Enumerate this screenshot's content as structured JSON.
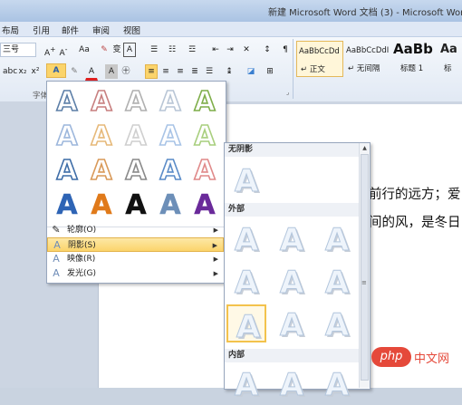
{
  "window": {
    "title": "新建 Microsoft Word 文档 (3) - Microsoft Word"
  },
  "ribbon": {
    "tabs": [
      "布局",
      "引用",
      "邮件",
      "审阅",
      "视图"
    ],
    "font_size_value": "三号",
    "font_group_label": "字体",
    "styles": [
      {
        "sample": "AaBbCcDd",
        "label": "↵ 正文"
      },
      {
        "sample": "AaBbCcDdI",
        "label": "↵ 无间隔"
      },
      {
        "sample": "AaBb",
        "label": "标题 1"
      },
      {
        "sample": "Aa",
        "label": "标"
      }
    ]
  },
  "document": {
    "lines": [
      "前行的远方；爱",
      "间的风，是冬日"
    ]
  },
  "text_effects_menu": {
    "menu_items": [
      {
        "icon": "pen-icon",
        "glyph": "✎",
        "label": "轮廓(O)"
      },
      {
        "icon": "shadow-a-icon",
        "glyph": "A",
        "label": "阴影(S)"
      },
      {
        "icon": "reflection-a-icon",
        "glyph": "A",
        "label": "映像(R)"
      },
      {
        "icon": "glow-a-icon",
        "glyph": "A",
        "label": "发光(G)"
      }
    ],
    "effect_colors": [
      [
        "#5d7fa8",
        "#c88080",
        "#b0b0b0",
        "#b9c6d6",
        "#7fae4a"
      ],
      [
        "#9db7dc",
        "#e6b97a",
        "#cfcfcf",
        "#a9c4e6",
        "#a9cf7f"
      ],
      [
        "#3f6ea8",
        "#d99a5a",
        "#8a8a8a",
        "#5b8cc8",
        "#e08a8a"
      ],
      [
        "#2e64b5",
        "#e07a1a",
        "#111111",
        "#6d8fb8",
        "#6a2a9a"
      ]
    ]
  },
  "shadow_menu": {
    "sections": [
      "无阴影",
      "外部",
      "内部"
    ],
    "glyph": "A",
    "highlight": "#f3c24c"
  }
}
